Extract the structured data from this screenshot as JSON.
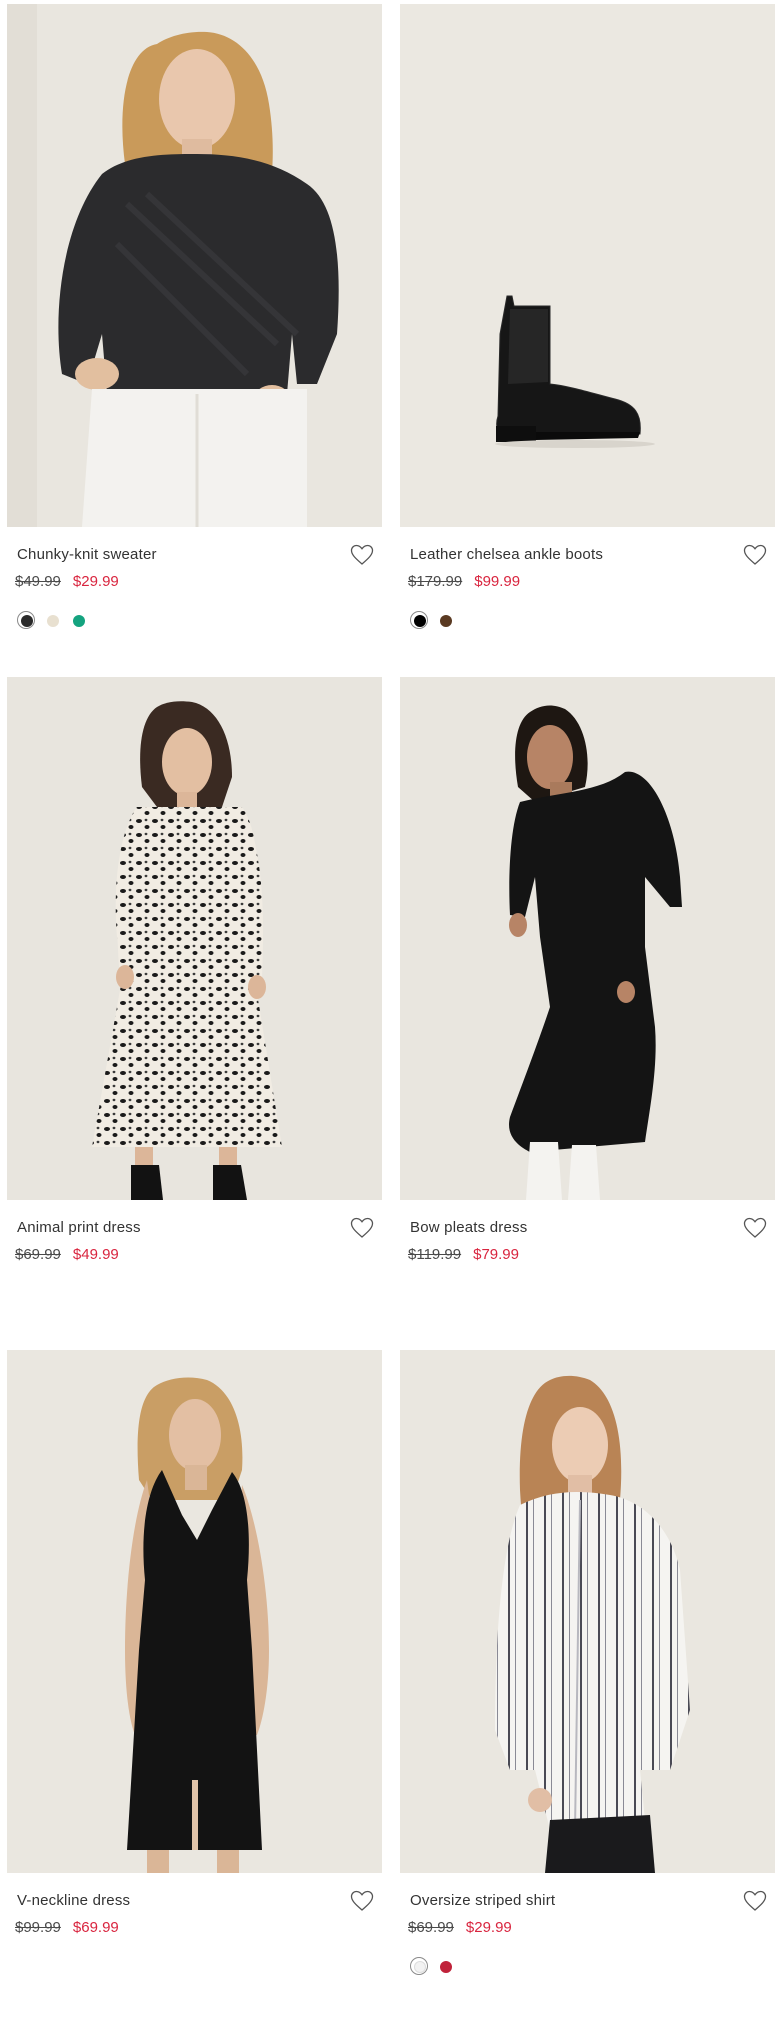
{
  "products": [
    {
      "name": "Chunky-knit sweater",
      "old_price": "$49.99",
      "new_price": "$29.99",
      "swatches": [
        "#2a2a2a",
        "#e8e0d0",
        "#14a37f"
      ]
    },
    {
      "name": "Leather chelsea ankle boots",
      "old_price": "$179.99",
      "new_price": "$99.99",
      "swatches": [
        "#000000",
        "#5a3a22"
      ]
    },
    {
      "name": "Animal print dress",
      "old_price": "$69.99",
      "new_price": "$49.99",
      "swatches": []
    },
    {
      "name": "Bow pleats dress",
      "old_price": "$119.99",
      "new_price": "$79.99",
      "swatches": []
    },
    {
      "name": "V-neckline dress",
      "old_price": "$99.99",
      "new_price": "$69.99",
      "swatches": []
    },
    {
      "name": "Oversize striped shirt",
      "old_price": "$69.99",
      "new_price": "$29.99",
      "swatches": [
        "#f2f2f2",
        "#c0223a"
      ]
    }
  ],
  "colors": {
    "sale_price": "#d9253f",
    "old_price": "#4a4a4a",
    "photo_background": "#ece9e3"
  },
  "icons": {
    "favorite": "heart-outline-icon"
  }
}
